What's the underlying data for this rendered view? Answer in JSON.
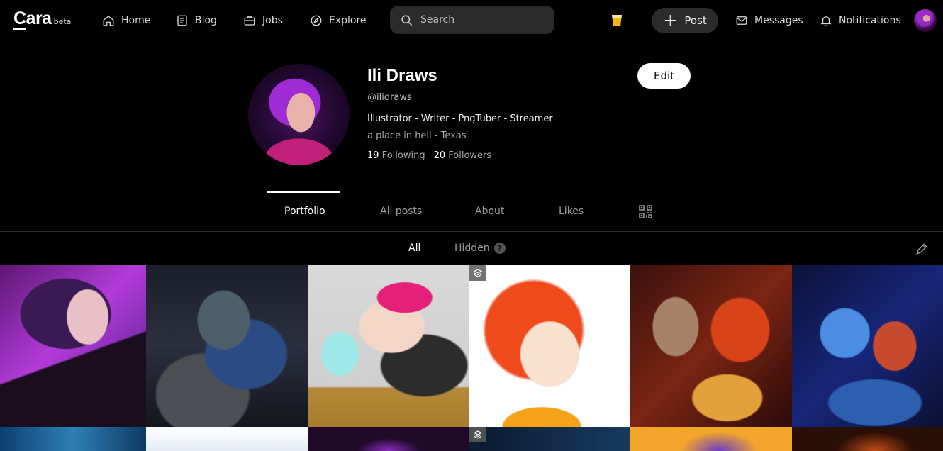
{
  "nav": {
    "logo": "Cara",
    "logo_badge": "beta",
    "items": [
      {
        "label": "Home",
        "icon": "home-icon"
      },
      {
        "label": "Blog",
        "icon": "blog-icon"
      },
      {
        "label": "Jobs",
        "icon": "briefcase-icon"
      },
      {
        "label": "Explore",
        "icon": "compass-icon"
      }
    ],
    "search_placeholder": "Search",
    "post_label": "Post",
    "messages_label": "Messages",
    "notifications_label": "Notifications"
  },
  "profile": {
    "name": "Ili Draws",
    "handle": "@ilidraws",
    "bio": "Illustrator - Writer - PngTuber - Streamer",
    "location": "a place in hell - Texas",
    "following_count": "19",
    "following_label": "Following",
    "followers_count": "20",
    "followers_label": "Followers",
    "edit_label": "Edit"
  },
  "tabs": {
    "portfolio": "Portfolio",
    "all_posts": "All posts",
    "about": "About",
    "likes": "Likes"
  },
  "filters": {
    "all": "All",
    "hidden": "Hidden",
    "help": "?"
  },
  "theme": {
    "background": "#000000",
    "accent_cup": "#f5b70a"
  }
}
